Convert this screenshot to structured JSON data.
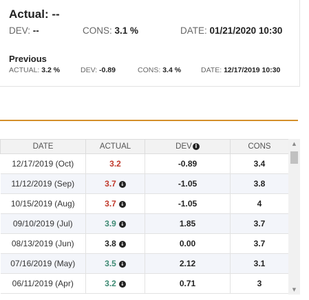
{
  "summary": {
    "title": "Actual: --",
    "dev_label": "DEV:",
    "dev_value": "--",
    "cons_label": "CONS:",
    "cons_value": "3.1 %",
    "date_label": "DATE:",
    "date_value": "01/21/2020 10:30"
  },
  "previous": {
    "title": "Previous",
    "actual_label": "ACTUAL:",
    "actual_value": "3.2 %",
    "dev_label": "DEV:",
    "dev_value": "-0.89",
    "cons_label": "CONS:",
    "cons_value": "3.4 %",
    "date_label": "DATE:",
    "date_value": "12/17/2019 10:30"
  },
  "table": {
    "headers": {
      "date": "DATE",
      "actual": "ACTUAL",
      "dev": "DEV",
      "cons": "CONS"
    },
    "rows": [
      {
        "date": "12/17/2019 (Oct)",
        "actual": "3.2",
        "actual_color": "#c0392b",
        "actual_icon": false,
        "dev": "-0.89",
        "cons": "3.4"
      },
      {
        "date": "11/12/2019 (Sep)",
        "actual": "3.7",
        "actual_color": "#c0392b",
        "actual_icon": true,
        "dev": "-1.05",
        "cons": "3.8"
      },
      {
        "date": "10/15/2019 (Aug)",
        "actual": "3.7",
        "actual_color": "#c0392b",
        "actual_icon": true,
        "dev": "-1.05",
        "cons": "4"
      },
      {
        "date": "09/10/2019 (Jul)",
        "actual": "3.9",
        "actual_color": "#3d8a73",
        "actual_icon": true,
        "dev": "1.85",
        "cons": "3.7"
      },
      {
        "date": "08/13/2019 (Jun)",
        "actual": "3.8",
        "actual_color": "#222222",
        "actual_icon": true,
        "dev": "0.00",
        "cons": "3.7"
      },
      {
        "date": "07/16/2019 (May)",
        "actual": "3.5",
        "actual_color": "#3d8a73",
        "actual_icon": true,
        "dev": "2.12",
        "cons": "3.1"
      },
      {
        "date": "06/11/2019 (Apr)",
        "actual": "3.2",
        "actual_color": "#3d8a73",
        "actual_icon": true,
        "dev": "0.71",
        "cons": "3"
      }
    ]
  },
  "colors": {
    "accent_line": "#d48f2a",
    "negative": "#c0392b",
    "positive": "#3d8a73"
  },
  "icons": {
    "info": "info-circle-icon",
    "scroll_up": "triangle-up-icon",
    "scroll_down": "triangle-down-icon"
  }
}
